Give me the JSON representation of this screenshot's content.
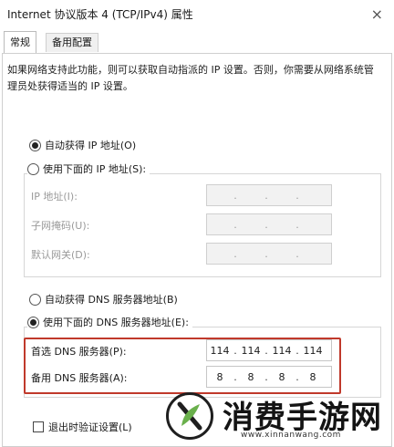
{
  "window": {
    "title": "Internet 协议版本 4 (TCP/IPv4) 属性",
    "close_label": "×"
  },
  "tabs": [
    {
      "label": "常规",
      "active": true
    },
    {
      "label": "备用配置",
      "active": false
    }
  ],
  "description": "如果网络支持此功能，则可以获取自动指派的 IP 设置。否则，你需要从网络系统管理员处获得适当的 IP 设置。",
  "ip_section": {
    "auto_label": "自动获得 IP 地址(O)",
    "auto_checked": true,
    "manual_label": "使用下面的 IP 地址(S):",
    "manual_checked": false,
    "fields": [
      {
        "label": "IP 地址(I):",
        "octets": [
          "",
          "",
          "",
          ""
        ]
      },
      {
        "label": "子网掩码(U):",
        "octets": [
          "",
          "",
          "",
          ""
        ]
      },
      {
        "label": "默认网关(D):",
        "octets": [
          "",
          "",
          "",
          ""
        ]
      }
    ]
  },
  "dns_section": {
    "auto_label": "自动获得 DNS 服务器地址(B)",
    "auto_checked": false,
    "manual_label": "使用下面的 DNS 服务器地址(E):",
    "manual_checked": true,
    "fields": [
      {
        "label": "首选 DNS 服务器(P):",
        "octets": [
          "114",
          "114",
          "114",
          "114"
        ]
      },
      {
        "label": "备用 DNS 服务器(A):",
        "octets": [
          "8",
          "8",
          "8",
          "8"
        ]
      }
    ]
  },
  "validate_label": "退出时验证设置(L)",
  "watermark": {
    "text": "消费手游网",
    "url": "www.xinnanwang.com",
    "logo_letter": "X"
  },
  "colors": {
    "highlight": "#c0392b",
    "watermark_green": "#6ab04c"
  }
}
